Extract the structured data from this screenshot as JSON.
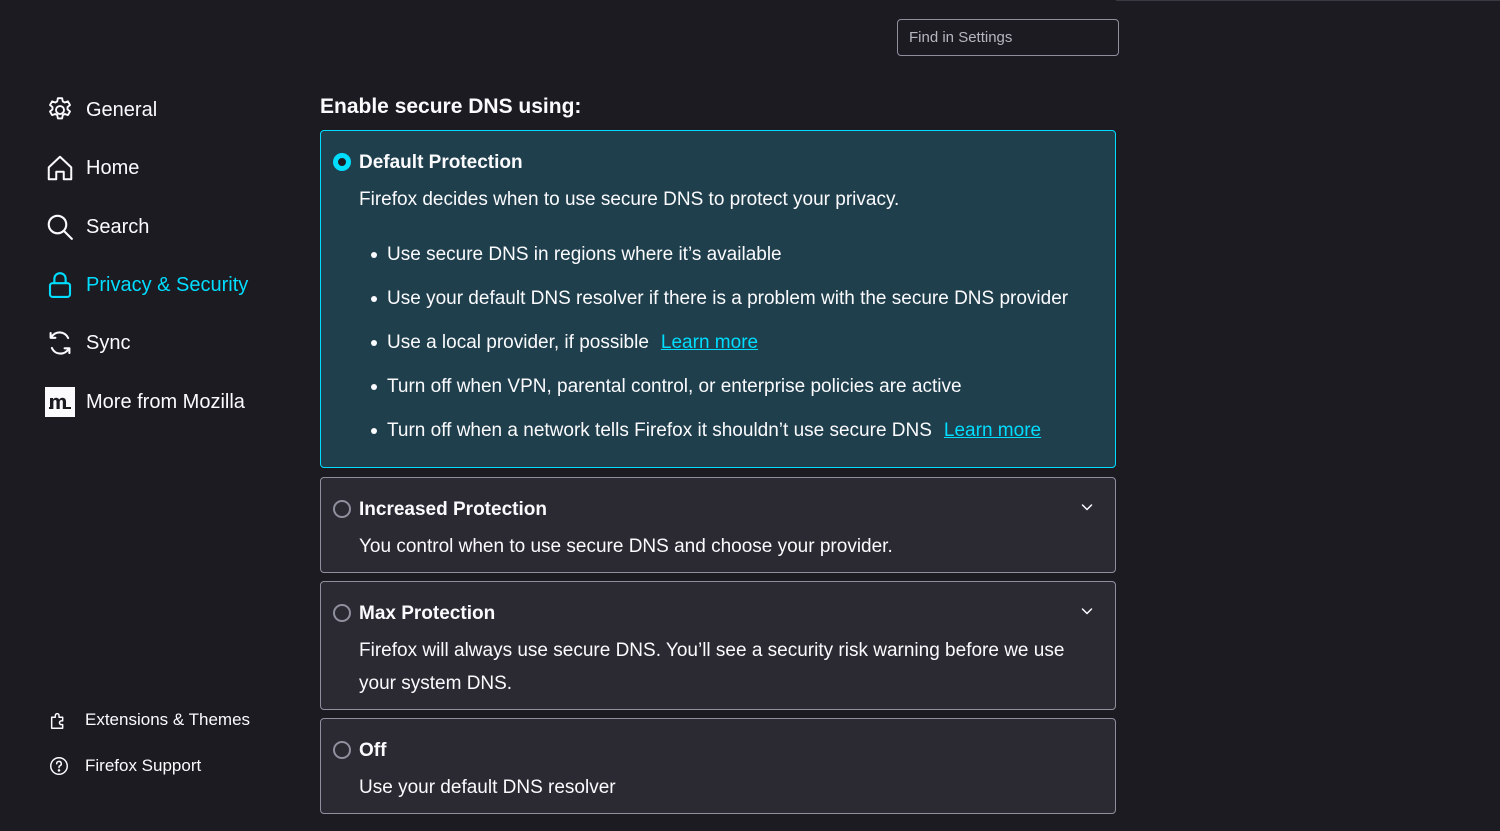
{
  "search": {
    "placeholder": "Find in Settings"
  },
  "sidebar": {
    "items": [
      {
        "label": "General",
        "icon": "gear-icon"
      },
      {
        "label": "Home",
        "icon": "home-icon"
      },
      {
        "label": "Search",
        "icon": "search-icon"
      },
      {
        "label": "Privacy & Security",
        "icon": "lock-icon",
        "active": true
      },
      {
        "label": "Sync",
        "icon": "sync-icon"
      },
      {
        "label": "More from Mozilla",
        "icon": "mozilla-icon"
      }
    ],
    "footer": [
      {
        "label": "Extensions & Themes",
        "icon": "puzzle-icon"
      },
      {
        "label": "Firefox Support",
        "icon": "help-icon"
      }
    ]
  },
  "section": {
    "heading": "Enable secure DNS using:"
  },
  "options": {
    "default": {
      "title": "Default Protection",
      "description": "Firefox decides when to use secure DNS to protect your privacy.",
      "selected": true,
      "bullets": [
        "Use secure DNS in regions where it’s available",
        "Use your default DNS resolver if there is a problem with the secure DNS provider",
        "Use a local provider, if possible",
        "Turn off when VPN, parental control, or enterprise policies are active",
        "Turn off when a network tells Firefox it shouldn’t use secure DNS"
      ],
      "learn_more_label": "Learn more"
    },
    "increased": {
      "title": "Increased Protection",
      "description": "You control when to use secure DNS and choose your provider.",
      "selected": false
    },
    "max": {
      "title": "Max Protection",
      "description": "Firefox will always use secure DNS. You’ll see a security risk warning before we use your system DNS.",
      "selected": false
    },
    "off": {
      "title": "Off",
      "description": "Use your default DNS resolver",
      "selected": false
    }
  },
  "colors": {
    "background": "#1c1b22",
    "accent": "#00ddff",
    "selected_card": "#1f3f4c",
    "card": "#2b2a33",
    "border": "#8f8f9d"
  }
}
